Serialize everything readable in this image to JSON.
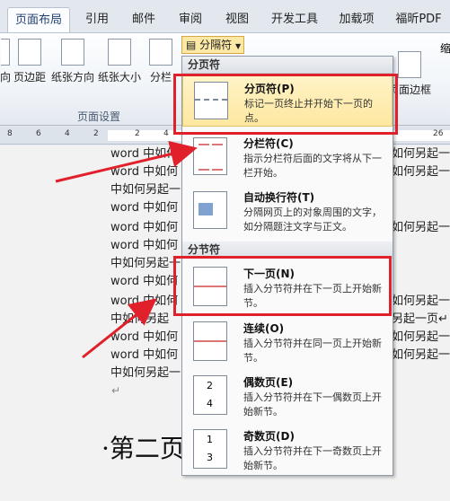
{
  "tabs": [
    {
      "label": "页面布局",
      "active": true
    },
    {
      "label": "引用"
    },
    {
      "label": "邮件"
    },
    {
      "label": "审阅"
    },
    {
      "label": "视图"
    },
    {
      "label": "开发工具"
    },
    {
      "label": "加载项"
    },
    {
      "label": "福昕PDF"
    }
  ],
  "ribbon": {
    "buttons": [
      "向",
      "页边距",
      "纸张方向",
      "纸张大小",
      "分栏",
      "页面边框"
    ],
    "split_button": "分隔符",
    "group_label": "页面设置",
    "right_cut": "缩"
  },
  "ruler": [
    "8",
    "6",
    "4",
    "2",
    "2",
    "4",
    "6",
    "8",
    "26"
  ],
  "menu": {
    "sections": [
      "分页符",
      "分节符"
    ],
    "items": [
      {
        "title": "分页符(P)",
        "desc": "标记一页终止并开始下一页的点。"
      },
      {
        "title": "分栏符(C)",
        "desc": "指示分栏符后面的文字将从下一栏开始。"
      },
      {
        "title": "自动换行符(T)",
        "desc": "分隔网页上的对象周围的文字，如分隔题注文字与正文。"
      },
      {
        "title": "下一页(N)",
        "desc": "插入分节符并在下一页上开始新节。"
      },
      {
        "title": "连续(O)",
        "desc": "插入分节符并在同一页上开始新节。"
      },
      {
        "title": "偶数页(E)",
        "desc": "插入分节符并在下一偶数页上开始新节。"
      },
      {
        "title": "奇数页(D)",
        "desc": "插入分节符并在下一奇数页上开始新节。"
      }
    ]
  },
  "doc": {
    "lines": [
      "word 中如何",
      "word 中如何",
      "中如何另起一",
      "word 中如何",
      "word 中如何",
      "word 中如何",
      "中如何另起一",
      "word 中如何",
      "word 中如何",
      "中如何另起",
      "word 中如何",
      "word 中如何",
      "中如何另起一"
    ],
    "right_lines": [
      "如何另起一",
      "如何另起一",
      "如何另起一",
      "如何另起一",
      "另起一页↵",
      "如何另起一",
      "如何另起一"
    ],
    "para_mark": "↵",
    "heading": "·第二页"
  },
  "colors": {
    "highlight": "#fee8a0",
    "annotation": "#e0212b"
  }
}
